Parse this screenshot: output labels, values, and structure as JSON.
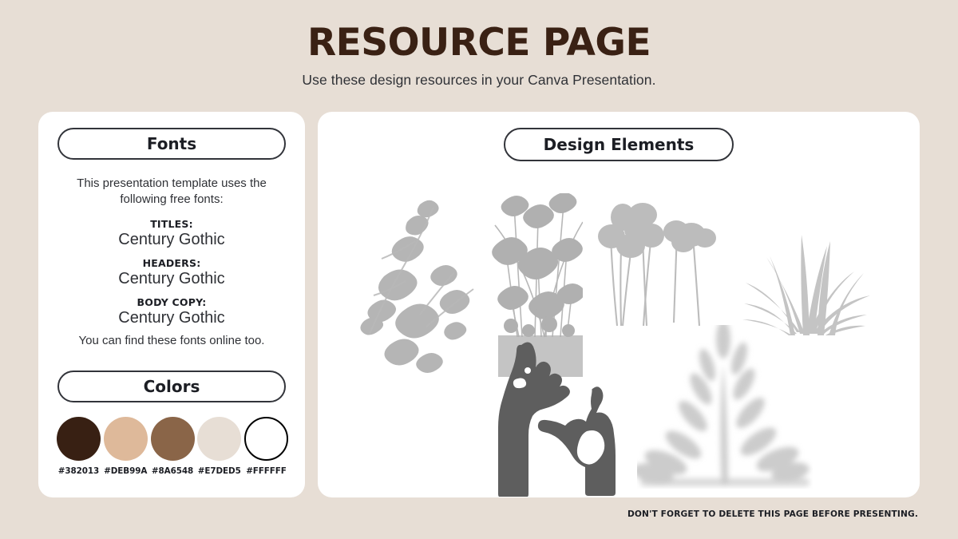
{
  "header": {
    "title": "RESOURCE PAGE",
    "subtitle": "Use these design resources in your Canva Presentation."
  },
  "fonts_panel": {
    "heading": "Fonts",
    "intro": "This presentation template uses the following free fonts:",
    "entries": [
      {
        "role": "TITLES:",
        "name": "Century Gothic"
      },
      {
        "role": "HEADERS:",
        "name": "Century Gothic"
      },
      {
        "role": "BODY COPY:",
        "name": "Century Gothic"
      }
    ],
    "outro": "You can find these fonts online too."
  },
  "colors_panel": {
    "heading": "Colors",
    "swatches": [
      {
        "hex": "#382013",
        "outlined": false
      },
      {
        "hex": "#DEB99A",
        "outlined": false
      },
      {
        "hex": "#8A6548",
        "outlined": false
      },
      {
        "hex": "#E7DED5",
        "outlined": false
      },
      {
        "hex": "#FFFFFF",
        "outlined": true
      }
    ]
  },
  "design_panel": {
    "heading": "Design Elements",
    "elements": [
      {
        "name": "leaf-branch-shadow",
        "tone": "#b4b4b4"
      },
      {
        "name": "billy-button-flowers-shadow",
        "tone": "#bdbdbd"
      },
      {
        "name": "grass-blades-shadow",
        "tone": "#c2c2c2"
      },
      {
        "name": "hands-silhouette",
        "tone": "#5d5d5d"
      },
      {
        "name": "soft-botanical-shadow",
        "tone": "#d0d0d0"
      }
    ]
  },
  "footer": {
    "note": "DON'T FORGET TO DELETE THIS PAGE BEFORE PRESENTING."
  },
  "theme": {
    "background": "#E7DED5",
    "card_background": "#FFFFFF",
    "title_color": "#3A2114",
    "text_color": "#2F3136",
    "outline_color": "#32343A"
  }
}
